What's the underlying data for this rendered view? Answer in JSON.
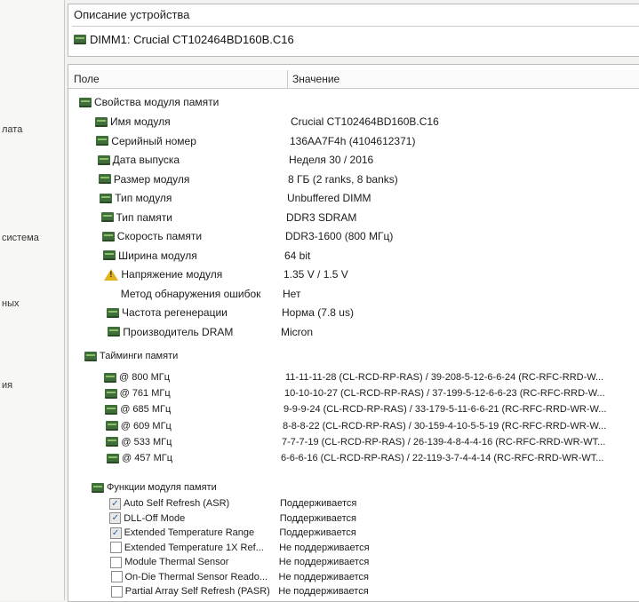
{
  "left_labels": [
    "лата",
    "система",
    "ных",
    "ия"
  ],
  "description": {
    "title": "Описание устройства",
    "device": "DIMM1: Crucial CT102464BD160B.C16"
  },
  "table": {
    "col_field": "Поле",
    "col_value": "Значение"
  },
  "module_props": {
    "title": "Свойства модуля памяти",
    "rows": [
      {
        "field": "Имя модуля",
        "value": "Crucial CT102464BD160B.C16",
        "icon": "memory-chip-icon"
      },
      {
        "field": "Серийный номер",
        "value": "136AA7F4h (4104612371)",
        "icon": "memory-chip-icon"
      },
      {
        "field": "Дата выпуска",
        "value": "Неделя 30 / 2016",
        "icon": "memory-chip-icon"
      },
      {
        "field": "Размер модуля",
        "value": "8 ГБ (2 ranks, 8 banks)",
        "icon": "memory-chip-icon"
      },
      {
        "field": "Тип модуля",
        "value": "Unbuffered DIMM",
        "icon": "memory-chip-icon"
      },
      {
        "field": "Тип памяти",
        "value": "DDR3 SDRAM",
        "icon": "memory-chip-icon"
      },
      {
        "field": "Скорость памяти",
        "value": "DDR3-1600 (800 МГц)",
        "icon": "memory-chip-icon"
      },
      {
        "field": "Ширина модуля",
        "value": "64 bit",
        "icon": "memory-chip-icon"
      },
      {
        "field": "Напряжение модуля",
        "value": "1.35 V / 1.5 V",
        "icon": "warning-icon"
      },
      {
        "field": "Метод обнаружения ошибок",
        "value": "Нет",
        "icon": "none"
      },
      {
        "field": "Частота регенерации",
        "value": "Норма (7.8 us)",
        "icon": "memory-chip-icon"
      },
      {
        "field": "Производитель DRAM",
        "value": "Micron",
        "icon": "memory-chip-icon"
      }
    ]
  },
  "timings": {
    "title": "Тайминги памяти",
    "rows": [
      {
        "field": "@ 800 МГц",
        "value": "11-11-11-28  (CL-RCD-RP-RAS) / 39-208-5-12-6-6-24  (RC-RFC-RRD-W..."
      },
      {
        "field": "@ 761 МГц",
        "value": "10-10-10-27  (CL-RCD-RP-RAS) / 37-199-5-12-6-6-23  (RC-RFC-RRD-W..."
      },
      {
        "field": "@ 685 МГц",
        "value": "9-9-9-24  (CL-RCD-RP-RAS) / 33-179-5-11-6-6-21  (RC-RFC-RRD-WR-W..."
      },
      {
        "field": "@ 609 МГц",
        "value": "8-8-8-22  (CL-RCD-RP-RAS) / 30-159-4-10-5-5-19  (RC-RFC-RRD-WR-W..."
      },
      {
        "field": "@ 533 МГц",
        "value": "7-7-7-19  (CL-RCD-RP-RAS) / 26-139-4-8-4-4-16  (RC-RFC-RRD-WR-WT..."
      },
      {
        "field": "@ 457 МГц",
        "value": "6-6-6-16  (CL-RCD-RP-RAS) / 22-119-3-7-4-4-14  (RC-RFC-RRD-WR-WT..."
      }
    ]
  },
  "features": {
    "title": "Функции модуля памяти",
    "rows": [
      {
        "field": "Auto Self Refresh (ASR)",
        "value": "Поддерживается",
        "checked": true
      },
      {
        "field": "DLL-Off Mode",
        "value": "Поддерживается",
        "checked": true
      },
      {
        "field": "Extended Temperature Range",
        "value": "Поддерживается",
        "checked": true
      },
      {
        "field": "Extended Temperature 1X Ref...",
        "value": "Не поддерживается",
        "checked": false
      },
      {
        "field": "Module Thermal Sensor",
        "value": "Не поддерживается",
        "checked": false
      },
      {
        "field": "On-Die Thermal Sensor Reado...",
        "value": "Не поддерживается",
        "checked": false
      },
      {
        "field": "Partial Array Self Refresh (PASR)",
        "value": "Не поддерживается",
        "checked": false
      }
    ]
  }
}
